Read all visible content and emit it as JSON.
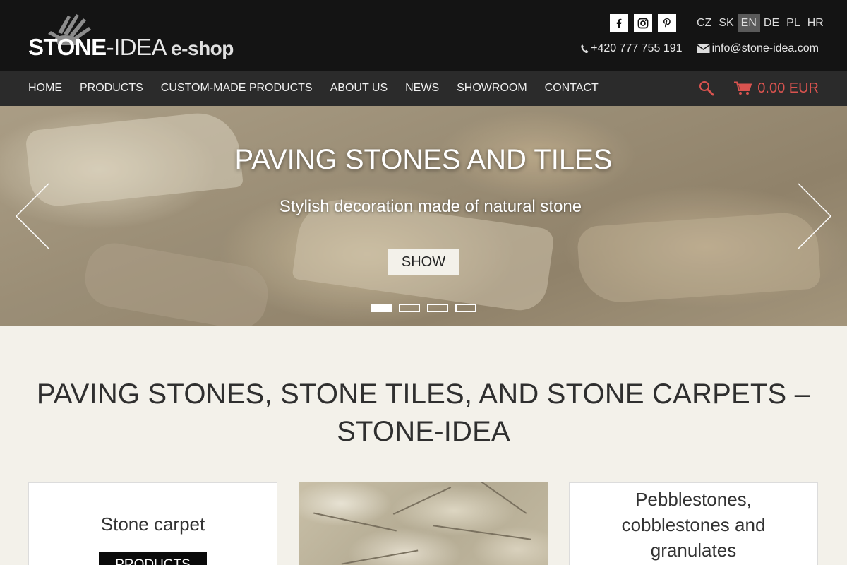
{
  "logo": {
    "part1": "STONE",
    "part2": "-IDEA",
    "part3": "e-shop"
  },
  "social": [
    {
      "name": "facebook",
      "icon": "facebook-icon"
    },
    {
      "name": "instagram",
      "icon": "instagram-icon"
    },
    {
      "name": "pinterest",
      "icon": "pinterest-icon"
    }
  ],
  "languages": [
    {
      "code": "CZ",
      "active": false
    },
    {
      "code": "SK",
      "active": false
    },
    {
      "code": "EN",
      "active": true
    },
    {
      "code": "DE",
      "active": false
    },
    {
      "code": "PL",
      "active": false
    },
    {
      "code": "HR",
      "active": false
    }
  ],
  "contact": {
    "phone": "+420 777 755 191",
    "email": "info@stone-idea.com"
  },
  "nav": {
    "items": [
      "HOME",
      "PRODUCTS",
      "CUSTOM-MADE PRODUCTS",
      "ABOUT US",
      "NEWS",
      "SHOWROOM",
      "CONTACT"
    ],
    "cart_total": "0.00 EUR"
  },
  "hero": {
    "title": "PAVING STONES AND TILES",
    "subtitle": "Stylish decoration made of natural stone",
    "button": "SHOW",
    "slides": 4,
    "active_slide": 1
  },
  "main": {
    "title": "PAVING STONES, STONE TILES, AND STONE CARPETS – STONE-IDEA",
    "cards": [
      {
        "title": "Stone carpet",
        "button": "PRODUCTS"
      },
      {
        "title": "",
        "image": "stone-tiles-photo"
      },
      {
        "title": "Pebblestones, cobblestones and granulates"
      }
    ]
  },
  "colors": {
    "accent": "#d9534f",
    "header_bg": "#141414",
    "nav_bg": "#2b2b2b",
    "page_bg": "#f3f1ea"
  }
}
